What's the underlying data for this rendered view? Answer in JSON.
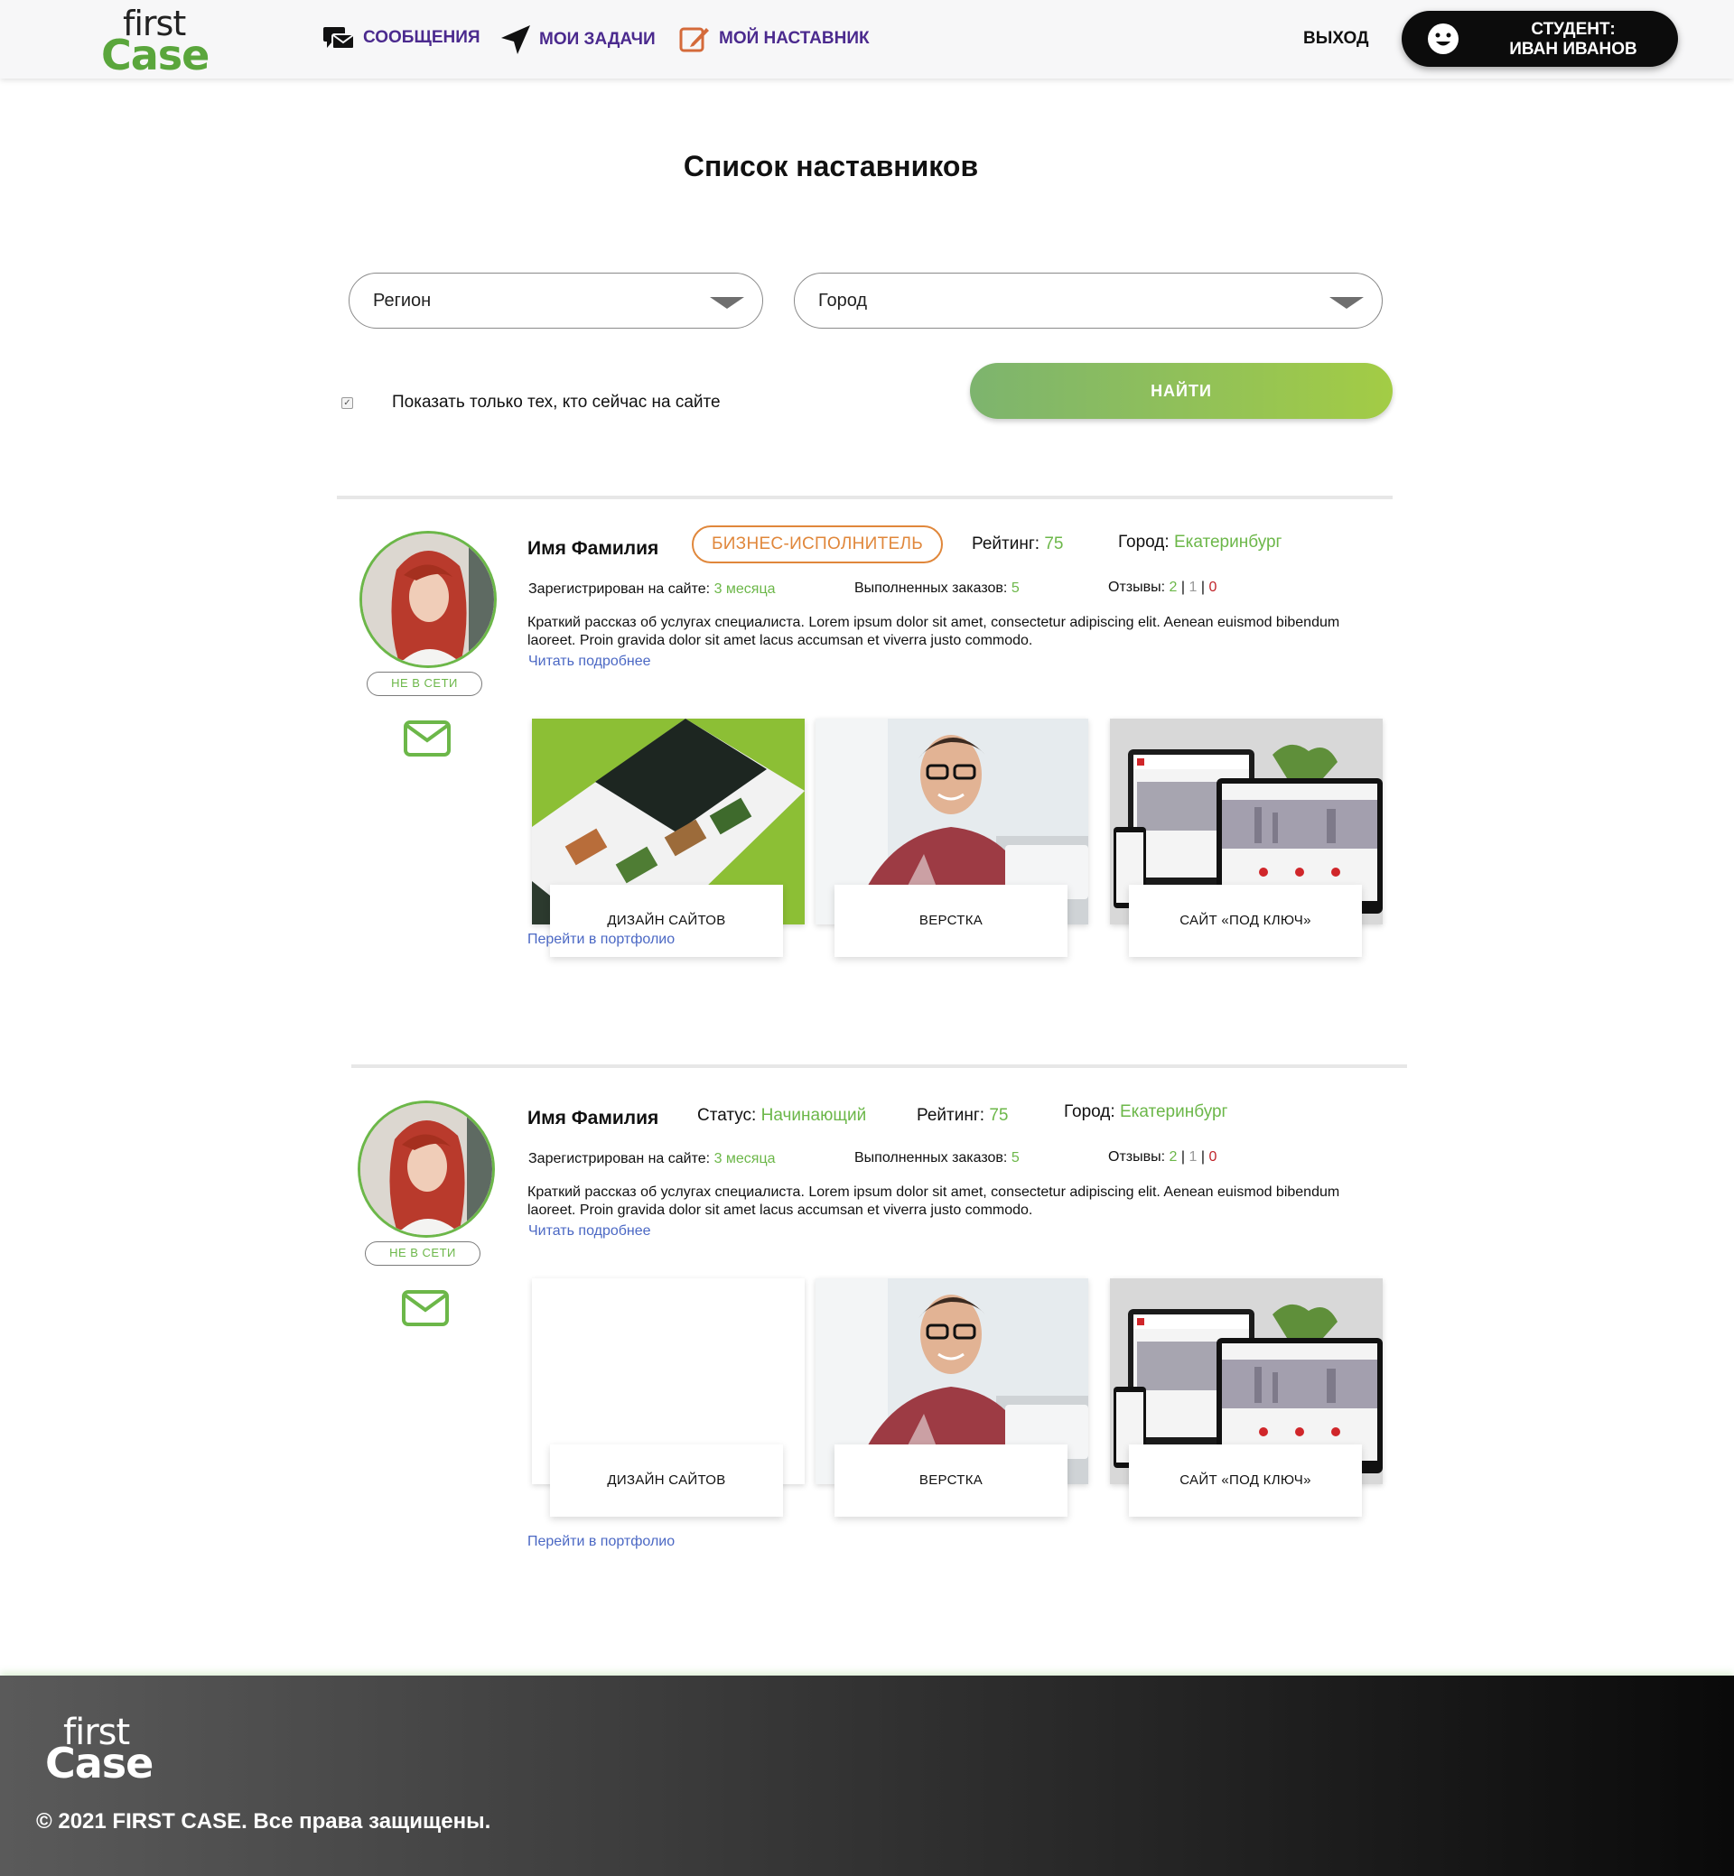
{
  "header": {
    "logo_line1": "first",
    "logo_line2": "Case",
    "nav": {
      "messages": "СООБЩЕНИЯ",
      "tasks": "МОИ ЗАДАЧИ",
      "mentor": "МОЙ НАСТАВНИК"
    },
    "logout": "ВЫХОД",
    "user_line1": "СТУДЕНТ:",
    "user_line2": "ИВАН ИВАНОВ"
  },
  "page_title": "Список наставников",
  "filters": {
    "region": "Регион",
    "city": "Город",
    "online_only_label": "Показать только тех, кто сейчас на сайте",
    "online_only_checked": true,
    "find_button": "НАЙТИ"
  },
  "mentors": [
    {
      "name": "Имя Фамилия",
      "badge": "БИЗНЕС-ИСПОЛНИТЕЛЬ",
      "rating_label": "Рейтинг:",
      "rating": "75",
      "city_label": "Город:",
      "city": "Екатеринбург",
      "registered_label": "Зарегистрирован на сайте:",
      "registered": "3 месяца",
      "orders_label": "Выполненных заказов:",
      "orders": "5",
      "reviews_label": "Отзывы:",
      "reviews_positive": "2",
      "reviews_neutral": "1",
      "reviews_negative": "0",
      "sep": "|",
      "description": "Краткий рассказ об услугах специалиста. Lorem ipsum dolor sit amet, consectetur adipiscing elit. Aenean euismod bibendum laoreet. Proin gravida dolor sit amet lacus accumsan et viverra justo commodo.",
      "read_more": "Читать подробнее",
      "online_status": "НЕ В СЕТИ",
      "portfolio": [
        "ДИЗАЙН САЙТОВ",
        "ВЕРСТКА",
        "САЙТ «ПОД КЛЮЧ»"
      ],
      "portfolio_link": "Перейти в портфолио"
    },
    {
      "name": "Имя Фамилия",
      "status_label": "Статус:",
      "status": "Начинающий",
      "rating_label": "Рейтинг:",
      "rating": "75",
      "city_label": "Город:",
      "city": "Екатеринбург",
      "registered_label": "Зарегистрирован на сайте:",
      "registered": "3 месяца",
      "orders_label": "Выполненных заказов:",
      "orders": "5",
      "reviews_label": "Отзывы:",
      "reviews_positive": "2",
      "reviews_neutral": "1",
      "reviews_negative": "0",
      "sep": "|",
      "description": "Краткий рассказ об услугах специалиста. Lorem ipsum dolor sit amet, consectetur adipiscing elit. Aenean euismod bibendum laoreet. Proin gravida dolor sit amet lacus accumsan et viverra justo commodo.",
      "read_more": "Читать подробнее",
      "online_status": "НЕ В СЕТИ",
      "portfolio": [
        "ДИЗАЙН САЙТОВ",
        "ВЕРСТКА",
        "САЙТ «ПОД КЛЮЧ»"
      ],
      "portfolio_link": "Перейти в портфолио"
    }
  ],
  "footer": {
    "logo_line1": "first",
    "logo_line2": "Case",
    "copyright": "© 2021 FIRST CASE. Все права защищены."
  },
  "colors": {
    "accent_green": "#6cb749",
    "nav_purple": "#4b2a8e",
    "badge_orange": "#e0873b",
    "link_blue": "#4b68c4",
    "negative_red": "#c0242a"
  }
}
